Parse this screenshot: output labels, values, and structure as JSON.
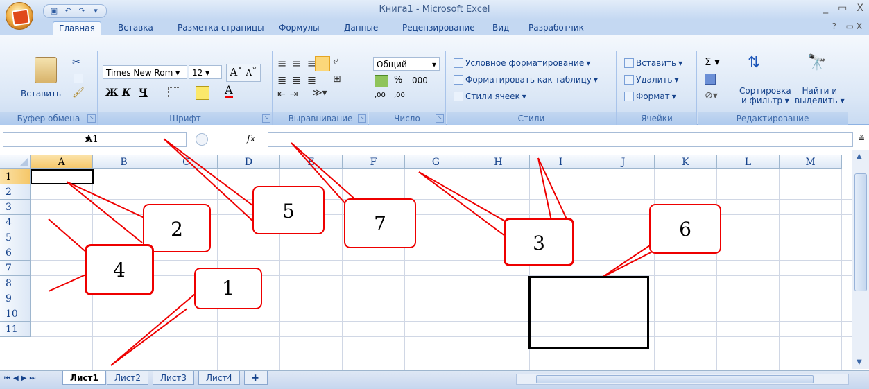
{
  "window": {
    "title": "Книга1 - Microsoft Excel",
    "controls": [
      "_",
      "▭",
      "X"
    ]
  },
  "ribbon_tabs": [
    "Главная",
    "Вставка",
    "Разметка страницы",
    "Формулы",
    "Данные",
    "Рецензирование",
    "Вид",
    "Разработчик"
  ],
  "ribbon": {
    "clipboard": {
      "paste_label": "Вставить",
      "group_label": "Буфер обмена"
    },
    "font": {
      "font_name": "Times New Rom",
      "font_size": "12",
      "bold": "Ж",
      "italic": "К",
      "underline": "Ч",
      "grow": "A",
      "shrink": "A",
      "font_color": "A",
      "group_label": "Шрифт"
    },
    "alignment": {
      "group_label": "Выравнивание"
    },
    "number": {
      "format": "Общий",
      "percent": "%",
      "thousands": "000",
      "inc_dec": ",00",
      "dec_dec": ",00",
      "group_label": "Число"
    },
    "styles": {
      "conditional": "Условное форматирование",
      "format_table": "Форматировать как таблицу",
      "cell_styles": "Стили ячеек",
      "group_label": "Стили"
    },
    "cells": {
      "insert": "Вставить",
      "delete": "Удалить",
      "format": "Формат",
      "group_label": "Ячейки"
    },
    "editing": {
      "sum": "Σ",
      "sort_line1": "Сортировка",
      "sort_line2": "и фильтр",
      "find_line1": "Найти и",
      "find_line2": "выделить",
      "group_label": "Редактирование"
    }
  },
  "formula_bar": {
    "name_box": "A1",
    "fx": "fx",
    "formula": ""
  },
  "columns": [
    "A",
    "B",
    "C",
    "D",
    "E",
    "F",
    "G",
    "H",
    "I",
    "J",
    "K",
    "L",
    "M"
  ],
  "rows": [
    "1",
    "2",
    "3",
    "4",
    "5",
    "6",
    "7",
    "8",
    "9",
    "10",
    "11"
  ],
  "selected_cell": "A1",
  "sheet_tabs": [
    "Лист1",
    "Лист2",
    "Лист3",
    "Лист4"
  ],
  "active_sheet": "Лист1",
  "callouts": [
    "1",
    "2",
    "3",
    "4",
    "5",
    "6",
    "7"
  ],
  "colors": {
    "annotation": "#e00000",
    "ribbon_bg": "#dbe7f6",
    "selection": "#f5c769"
  }
}
